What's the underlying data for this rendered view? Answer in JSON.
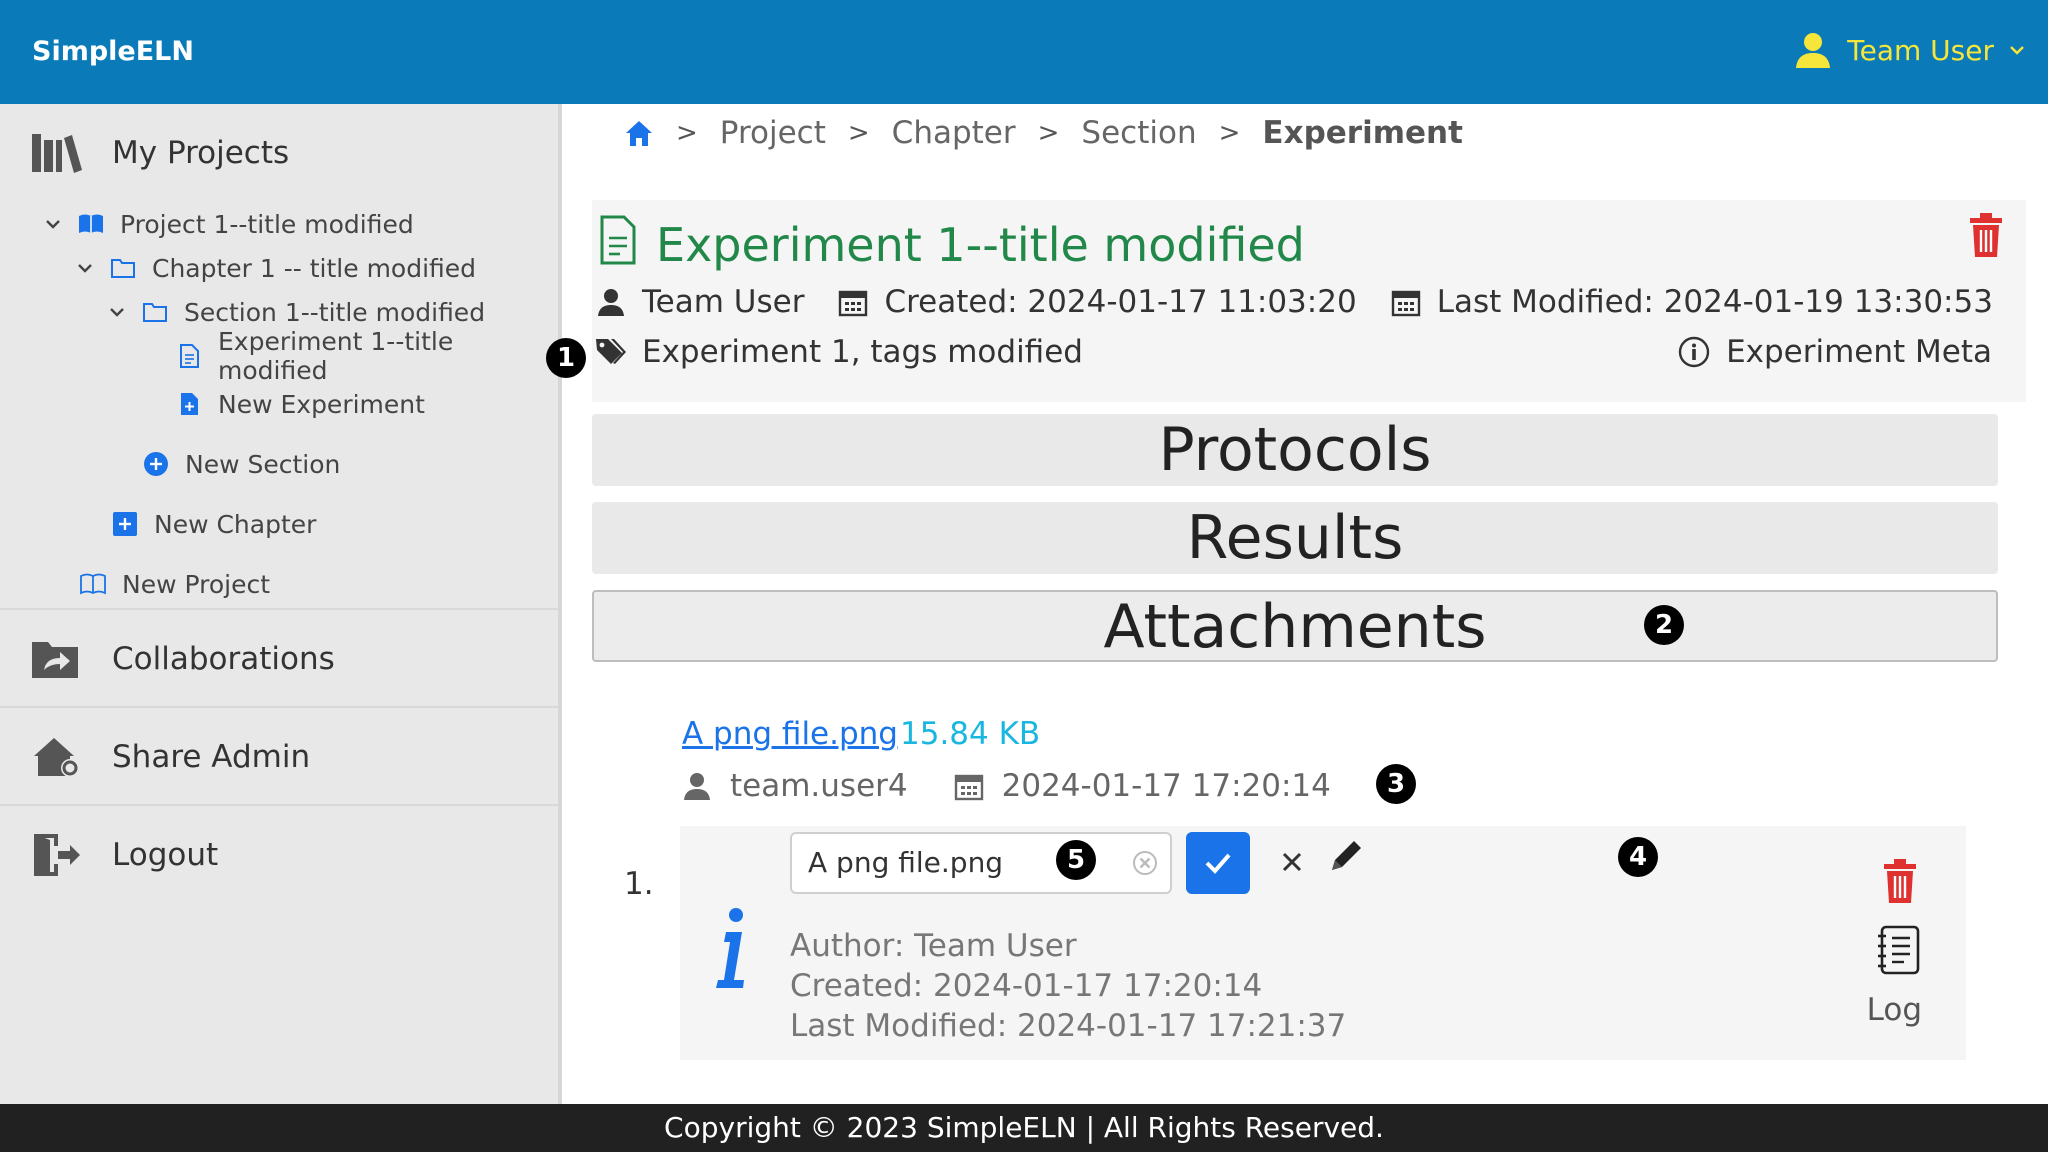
{
  "app": {
    "brand": "SimpleELN"
  },
  "user_menu": {
    "name": "Team User"
  },
  "sidebar": {
    "my_projects": "My Projects",
    "tree": {
      "project": "Project 1--title modified",
      "chapter": "Chapter 1 -- title modified",
      "section": "Section 1--title modified",
      "experiment": "Experiment 1--title modified",
      "new_experiment": "New Experiment",
      "new_section": "New Section",
      "new_chapter": "New Chapter",
      "new_project": "New Project"
    },
    "collaborations": "Collaborations",
    "share_admin": "Share Admin",
    "logout": "Logout"
  },
  "breadcrumb": {
    "items": [
      "Project",
      "Chapter",
      "Section"
    ],
    "current": "Experiment"
  },
  "experiment": {
    "title": "Experiment 1--title modified",
    "author": "Team User",
    "created": "Created: 2024-01-17 11:03:20",
    "modified": "Last Modified: 2024-01-19 13:30:53",
    "tags": "Experiment 1, tags modified",
    "meta_link": "Experiment Meta"
  },
  "sections": {
    "protocols": "Protocols",
    "results": "Results",
    "attachments": "Attachments"
  },
  "attachment": {
    "index": "1.",
    "filename": "A png file.png",
    "size": "15.84 KB",
    "uploader": "team.user4",
    "uploaded": "2024-01-17 17:20:14",
    "rename_value": "A png file.png",
    "author": "Author:  Team User",
    "created": "Created:  2024-01-17 17:20:14",
    "modified": "Last Modified:  2024-01-17 17:21:37",
    "log_label": "Log"
  },
  "badges": [
    "1",
    "2",
    "3",
    "4",
    "5"
  ],
  "footer": {
    "text": "Copyright © 2023 SimpleELN | All Rights Reserved."
  },
  "colors": {
    "topbar": "#0a7bb8",
    "accent_user": "#f6e53a",
    "title_green": "#22884a",
    "link_blue": "#1a73e8",
    "size_cyan": "#19b6e0",
    "danger": "#e03131",
    "footer": "#212121"
  }
}
